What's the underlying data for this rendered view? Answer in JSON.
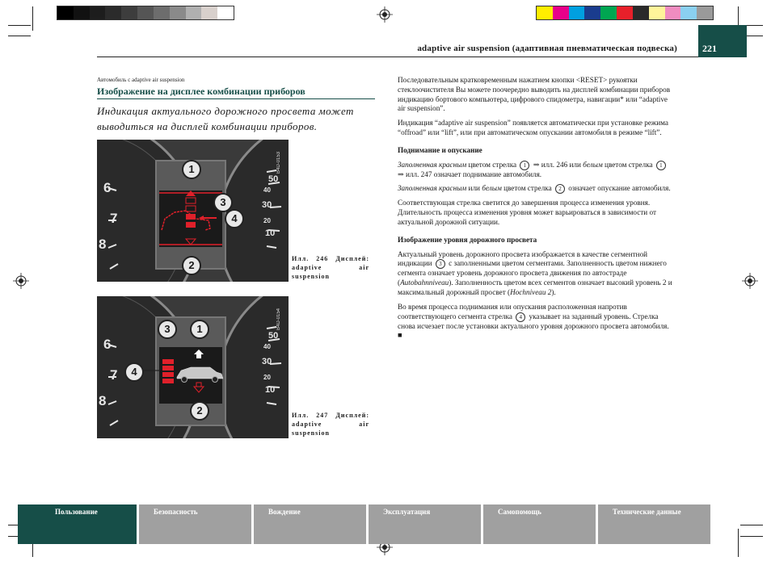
{
  "colors": {
    "brand": "#164e48",
    "display_red": "#e0202a",
    "cluster_face": "#2c2c2c",
    "display_bg": "#4a4a4a",
    "nav_inactive": "#a0a0a0"
  },
  "calibration_colors_gray": [
    "#000000",
    "#111111",
    "#1d1d1d",
    "#2b2b2b",
    "#3d3d3d",
    "#555555",
    "#6d6d6d",
    "#8a8a8a",
    "#b0b0b0",
    "#d8d0cc",
    "#ffffff"
  ],
  "calibration_colors_color": [
    "#ffee00",
    "#e8008a",
    "#00a0e0",
    "#1a3c8e",
    "#00a651",
    "#e8202a",
    "#2a2a2a",
    "#fff59a",
    "#f08cc0",
    "#8ad0f0",
    "#9a9a9a"
  ],
  "header": {
    "title": "adaptive air suspension (адаптивная пневматическая подвеска)",
    "page_number": "221"
  },
  "left": {
    "breadcrumb": "Автомобиль с adaptive air suspension",
    "section_title": "Изображение на дисплее комбинации приборов",
    "lead": "Индикация актуального дорожного просвета может выводиться на дисплей комбинации приборов."
  },
  "figure1": {
    "code": "B4D-0153",
    "caption": "Илл. 246 Дисплей: adaptive air suspension",
    "callouts": [
      "1",
      "2",
      "3",
      "4"
    ],
    "tach_ticks": [
      "6",
      "7",
      "8"
    ],
    "speed_ticks": [
      "50",
      "40",
      "30",
      "20",
      "10"
    ]
  },
  "figure2": {
    "code": "B4D-0154",
    "caption": "Илл. 247 Дисплей: adaptive air suspension",
    "callouts": [
      "3",
      "1",
      "4",
      "2"
    ],
    "tach_ticks": [
      "6",
      "7",
      "8"
    ],
    "speed_ticks": [
      "50",
      "40",
      "30",
      "20",
      "10"
    ]
  },
  "right": {
    "p1": "Последовательным кратковременным нажатием кнопки <RESET> рукоятки стеклоочистителя Вы можете поочередно выводить на дисплей комбинации приборов индикацию бортового компьютера, цифрового спидометра, навигации* или “adaptive air suspension”.",
    "p2": "Индикация “adaptive air suspension” появляется автоматически при установке режима “offroad” или “lift”, или при автоматическом опускании автомобиля в режиме “lift”.",
    "h1": "Поднимание и опускание",
    "p3_a": "Заполненная красным",
    "p3_b": " цветом стрелка ",
    "p3_c": "1",
    "p3_d": " ⇒ илл. 246 или ",
    "p3_e": "белым",
    "p3_f": " цветом стрелка ",
    "p3_g": "1",
    "p3_h": " ⇒ илл. 247 означает поднимание автомобиля.",
    "p4_a": "Заполненная красным",
    "p4_b": " или ",
    "p4_c": "белым",
    "p4_d": " цветом стрелка ",
    "p4_e": "2",
    "p4_f": " означает опускание автомобиля.",
    "p5": "Соответствующая стрелка светится до завершения процесса изменения уровня. Длительность процесса изменения уровня может варьироваться в зависимости от актуальной дорожной ситуации.",
    "h2": "Изображение уровня дорожного просвета",
    "p6_a": "Актуальный уровень дорожного просвета изображается в качестве сегментной индикации ",
    "p6_b": "3",
    "p6_c": " с заполненными цветом сегментами. Заполненность цветом нижнего сегмента означает уровень дорожного просвета движения по автостраде (",
    "p6_d": "Autobahnniveau",
    "p6_e": "). Заполненность цветом всех сегментов означает высокий уровень 2 и максимальный дорожный просвет (",
    "p6_f": "Hochniveau 2",
    "p6_g": ").",
    "p7_a": "Во время процесса поднимания или опускания расположенная напротив соответствующего сегмента стрелка ",
    "p7_b": "4",
    "p7_c": " указывает на заданный уровень. Стрелка снова исчезает после установки актуального уровня дорожного просвета автомобиля. ■"
  },
  "nav": {
    "tabs": [
      "Пользование",
      "Безопасность",
      "Вождение",
      "Эксплуатация",
      "Самопомощь",
      "Технические данные"
    ]
  }
}
